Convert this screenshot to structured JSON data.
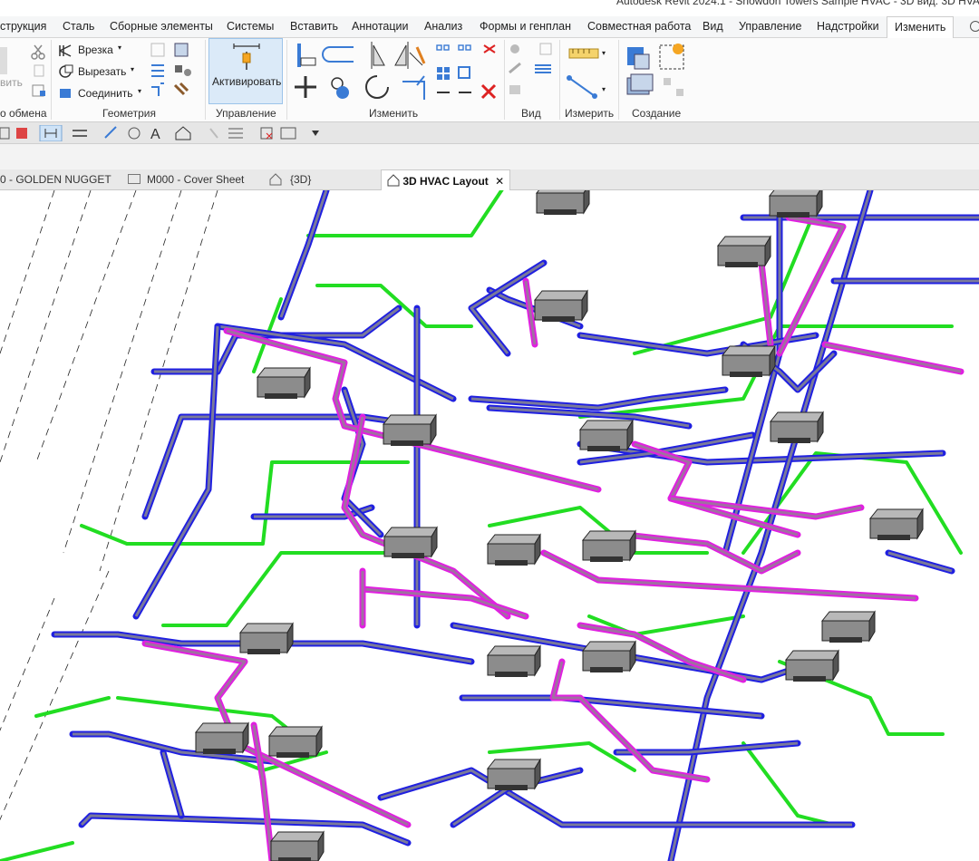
{
  "window": {
    "title": "Autodesk Revit 2024.1 - Snowdon Towers Sample HVAC - 3D вид: 3D HVAC"
  },
  "menu": {
    "items": [
      "струкция",
      "Сталь",
      "Сборные элементы",
      "Системы",
      "Вставить",
      "Аннотации",
      "Анализ",
      "Формы и генплан",
      "Совместная работа",
      "Вид",
      "Управление",
      "Надстройки",
      "Изменить"
    ],
    "active": "Изменить"
  },
  "ribbon": {
    "clipboard": {
      "label": "о обмена",
      "partial_text": "вить"
    },
    "geometry": {
      "label": "Геометрия",
      "cut_in": "Врезка",
      "cut": "Вырезать",
      "join": "Соединить"
    },
    "control": {
      "label": "Управление",
      "activate": "Активировать"
    },
    "modify": {
      "label": "Изменить"
    },
    "view": {
      "label": "Вид"
    },
    "measure": {
      "label": "Измерить"
    },
    "create": {
      "label": "Создание"
    }
  },
  "view_tabs": [
    {
      "label": "0 - GOLDEN NUGGET",
      "icon": "none"
    },
    {
      "label": "M000 - Cover Sheet",
      "icon": "sheet-icon"
    },
    {
      "label": "{3D}",
      "icon": "house-icon"
    },
    {
      "label": "3D HVAC Layout",
      "icon": "house-icon",
      "active": true
    }
  ],
  "colors": {
    "supply_duct": "#2020e0",
    "return_duct": "#e020e0",
    "pipe": "#22dd22",
    "duct_core": "#7a7a9a",
    "equipment": "#8c8c8c",
    "accent": "#1a73c8"
  }
}
